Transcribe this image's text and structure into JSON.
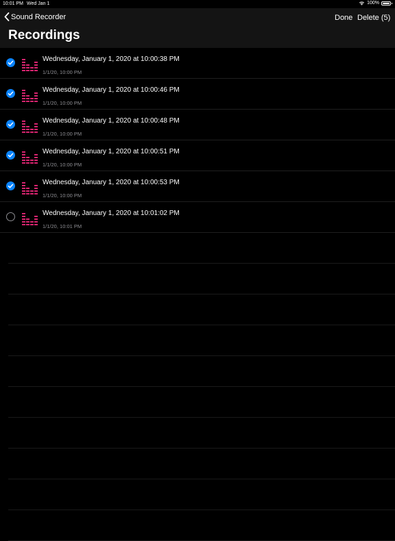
{
  "status": {
    "time": "10:01 PM",
    "date": "Wed Jan 1",
    "battery": "100%",
    "icons": [
      "wifi-icon",
      "battery-icon"
    ]
  },
  "nav": {
    "back_label": "Sound Recorder",
    "done_label": "Done",
    "delete_label": "Delete (5)",
    "title": "Recordings"
  },
  "colors": {
    "accent": "#0a84ff",
    "waveform": "#d6246e",
    "background": "#000000",
    "nav_background": "#141414",
    "secondary_text": "#8e8e93"
  },
  "recordings": [
    {
      "title": "Wednesday, January 1, 2020 at 10:00:38 PM",
      "subtitle": "1/1/20, 10:00 PM",
      "selected": true
    },
    {
      "title": "Wednesday, January 1, 2020 at 10:00:46 PM",
      "subtitle": "1/1/20, 10:00 PM",
      "selected": true
    },
    {
      "title": "Wednesday, January 1, 2020 at 10:00:48 PM",
      "subtitle": "1/1/20, 10:00 PM",
      "selected": true
    },
    {
      "title": "Wednesday, January 1, 2020 at 10:00:51 PM",
      "subtitle": "1/1/20, 10:00 PM",
      "selected": true
    },
    {
      "title": "Wednesday, January 1, 2020 at 10:00:53 PM",
      "subtitle": "1/1/20, 10:00 PM",
      "selected": true
    },
    {
      "title": "Wednesday, January 1, 2020 at 10:01:02 PM",
      "subtitle": "1/1/20, 10:01 PM",
      "selected": false
    }
  ]
}
